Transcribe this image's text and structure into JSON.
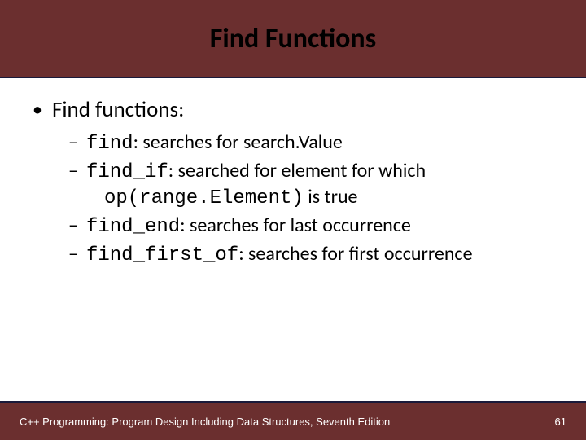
{
  "title": "Find Functions",
  "bullet_main": "Find functions:",
  "items": [
    {
      "code": "find",
      "desc": ": searches for search.Value"
    },
    {
      "code": "find_if",
      "desc": ": searched for element for which",
      "cont_code": "op(range.Element)",
      "cont_tail": " is true"
    },
    {
      "code": "find_end",
      "desc": ": searches for last occurrence"
    },
    {
      "code": "find_first_of",
      "desc": ": searches for first occurrence"
    }
  ],
  "footer": {
    "text": "C++ Programming: Program Design Including Data Structures, Seventh Edition",
    "page": "61"
  }
}
